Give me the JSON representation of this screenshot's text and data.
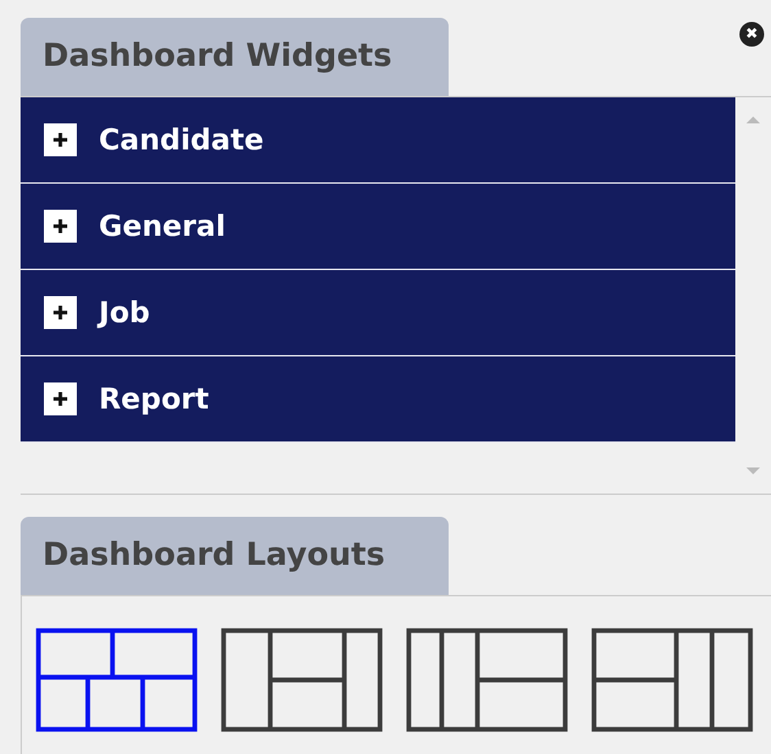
{
  "widgets_panel": {
    "title": "Dashboard Widgets",
    "close_symbol": "✖",
    "categories": [
      {
        "label": "Candidate",
        "expanded": false
      },
      {
        "label": "General",
        "expanded": false
      },
      {
        "label": "Job",
        "expanded": false
      },
      {
        "label": "Report",
        "expanded": false
      }
    ]
  },
  "layouts_panel": {
    "title": "Dashboard Layouts",
    "layouts": [
      {
        "kind": "grid",
        "selected": true
      },
      {
        "kind": "middle",
        "selected": false
      },
      {
        "kind": "right",
        "selected": false
      },
      {
        "kind": "left",
        "selected": false
      }
    ]
  }
}
